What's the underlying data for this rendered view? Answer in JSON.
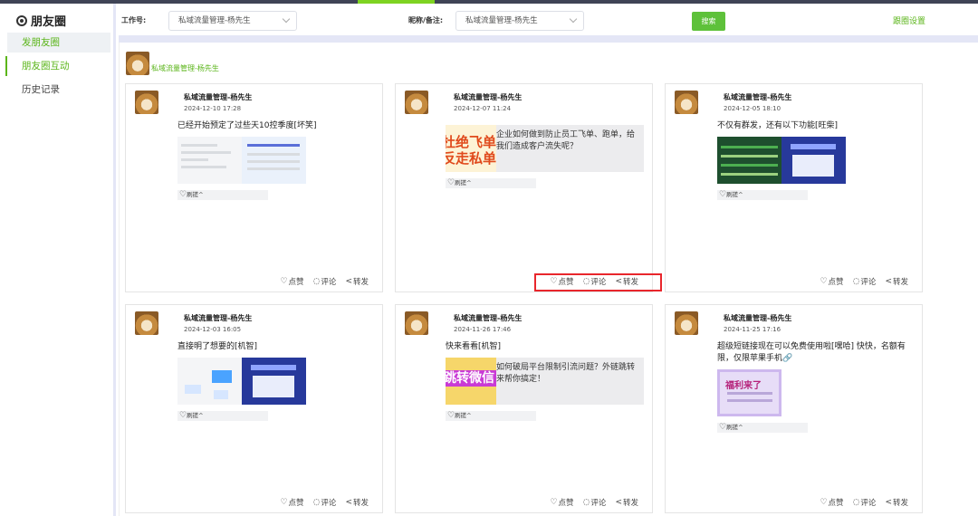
{
  "sidebar": {
    "title": "朋友圈",
    "items": [
      {
        "label": "发朋友圈"
      },
      {
        "label": "朋友圈互动"
      },
      {
        "label": "历史记录"
      }
    ]
  },
  "header": {
    "work_label": "工作号:",
    "work_value": "私域流量管理-杨先生",
    "nick_label": "昵称/备注:",
    "nick_value": "私域流量管理-杨先生",
    "search_label": "搜索",
    "follow_link": "跟圈设置"
  },
  "account": {
    "name": "私域流量管理-杨先生"
  },
  "posts": [
    {
      "name": "私域流量管理-杨先生",
      "time": "2024-12-10 17:28",
      "text": "已经开始预定了过些天10控季度[坏笑]",
      "likes": "刷搓^",
      "like": "点赞",
      "comment": "评论",
      "share": "转发"
    },
    {
      "name": "私域流量管理-杨先生",
      "time": "2024-12-07 11:24",
      "link_text": "企业如何做到防止员工飞单、跑单，给我们造成客户流失呢？",
      "link_thumb_text": "杜绝飞单 反走私单",
      "likes": "刷搓^",
      "like": "点赞",
      "comment": "评论",
      "share": "转发"
    },
    {
      "name": "私域流量管理-杨先生",
      "time": "2024-12-05 18:10",
      "text": "不仅有群发，还有以下功能[旺柴]",
      "likes": "刷搓^",
      "like": "点赞",
      "comment": "评论",
      "share": "转发"
    },
    {
      "name": "私域流量管理-杨先生",
      "time": "2024-12-03 16:05",
      "text": "直接明了想要的[机智]",
      "likes": "刷搓^",
      "like": "点赞",
      "comment": "评论",
      "share": "转发"
    },
    {
      "name": "私域流量管理-杨先生",
      "time": "2024-11-26 17:46",
      "text": "快来看看[机智]",
      "link_text": "如何破局平台限制引流问题？外链跳转来帮你搞定！",
      "link_thumb_text": "跳转微信",
      "likes": "刷搓^",
      "like": "点赞",
      "comment": "评论",
      "share": "转发"
    },
    {
      "name": "私域流量管理-杨先生",
      "time": "2024-11-25 17:16",
      "text": "超级短链接现在可以免费使用啦[嘿哈] 快快，名额有限，仅限苹果手机🔗",
      "poster_text": "福利来了",
      "likes": "刷搓^",
      "like": "点赞",
      "comment": "评论",
      "share": "转发"
    }
  ]
}
